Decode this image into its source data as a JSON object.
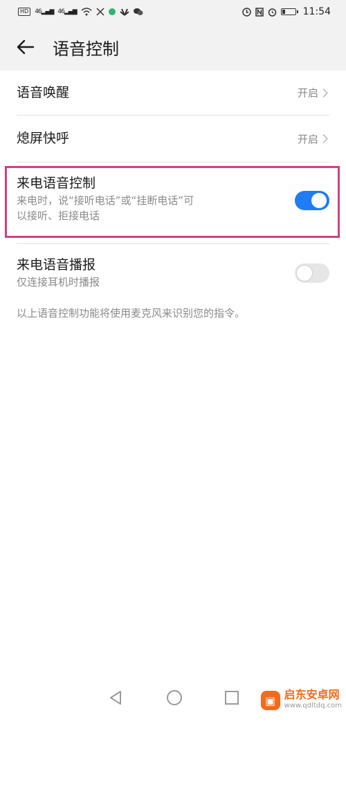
{
  "statusbar": {
    "hd_label": "HD",
    "sig1": "46",
    "sig2": "46",
    "time": "11:54",
    "icons": [
      "hd-icon",
      "signal-icon",
      "signal-icon",
      "wifi-icon",
      "missed-call-icon",
      "app-icon",
      "huawei-icon",
      "wechat-icon",
      "alarm-icon",
      "nfc-icon",
      "clock-icon",
      "battery-icon"
    ]
  },
  "appbar": {
    "title": "语音控制"
  },
  "settings": [
    {
      "label": "语音唤醒",
      "value": "开启"
    },
    {
      "label": "熄屏快呼",
      "value": "开启"
    },
    {
      "label": "来电语音控制",
      "sub_line1": "来电时，说“接听电话”或“挂断电话”可",
      "sub_line2": "以接听、拒接电话",
      "toggle": "on"
    },
    {
      "label": "来电语音播报",
      "sub_line1": "仅连接耳机时播报",
      "toggle": "off"
    }
  ],
  "footer_note": "以上语音控制功能将使用麦克风来识别您的指令。",
  "watermark": {
    "main": "启东安卓网",
    "url": "www.qdltdq.com"
  },
  "colors": {
    "accent": "#1f7cf5",
    "highlight": "#d63f7f",
    "brand": "#f26a1b"
  }
}
